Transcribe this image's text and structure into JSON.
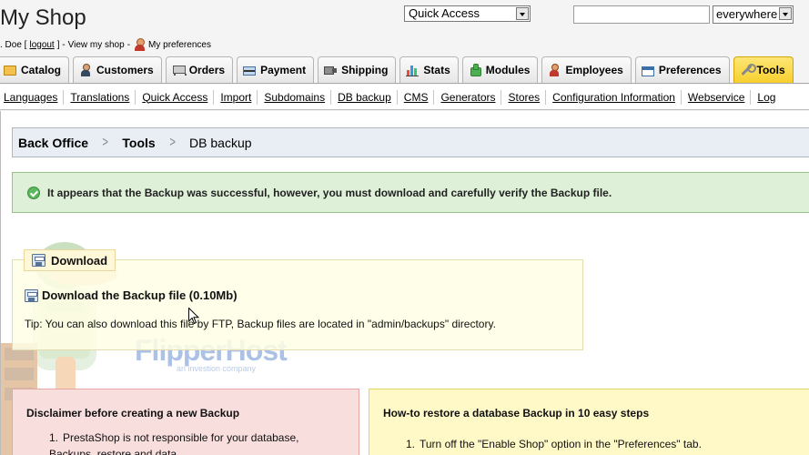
{
  "header": {
    "shop_title": "My Shop",
    "user_prefix": ". Doe [",
    "logout": "logout",
    "user_suffix": "] -",
    "view_shop": "View my shop",
    "dash": "-",
    "my_preferences": "My preferences",
    "quick_access": "Quick Access",
    "search_value": "",
    "search_scope": "everywhere"
  },
  "tabs": [
    {
      "label": "Catalog",
      "icon": "folder-icon"
    },
    {
      "label": "Customers",
      "icon": "customers-icon"
    },
    {
      "label": "Orders",
      "icon": "cart-icon"
    },
    {
      "label": "Payment",
      "icon": "credit-card-icon"
    },
    {
      "label": "Shipping",
      "icon": "truck-icon"
    },
    {
      "label": "Stats",
      "icon": "bar-chart-icon"
    },
    {
      "label": "Modules",
      "icon": "puzzle-icon"
    },
    {
      "label": "Employees",
      "icon": "employee-icon"
    },
    {
      "label": "Preferences",
      "icon": "window-icon"
    },
    {
      "label": "Tools",
      "icon": "wrench-icon",
      "active": true
    }
  ],
  "subnav": [
    "Languages",
    "Translations",
    "Quick Access",
    "Import",
    "Subdomains",
    "DB backup",
    "CMS",
    "Generators",
    "Stores",
    "Configuration Information",
    "Webservice",
    "Log"
  ],
  "breadcrumb": [
    "Back Office",
    "Tools",
    "DB backup"
  ],
  "success_message": "It appears that the Backup was successful, however, you must download and carefully verify the Backup file.",
  "download": {
    "legend": "Download",
    "link": "Download the Backup file (0.10Mb)",
    "tip": "Tip: You can also download this file by FTP, Backup files are located in \"admin/backups\" directory."
  },
  "watermark": {
    "name": "FlipperHost",
    "sub": "an investion company"
  },
  "disclaimer": {
    "title": "Disclaimer before creating a new Backup",
    "items": [
      "PrestaShop is not responsible for your database, Backups, restore and data."
    ]
  },
  "howto": {
    "title": "How-to restore a database Backup in 10 easy steps",
    "items": [
      "Turn off the \"Enable Shop\" option in the \"Preferences\" tab."
    ]
  },
  "colors": {
    "active_tab": "#f7cf2e",
    "success_bg": "#dff0d8",
    "disclaimer_bg": "#f9dede",
    "howto_bg": "#fff9c8"
  }
}
